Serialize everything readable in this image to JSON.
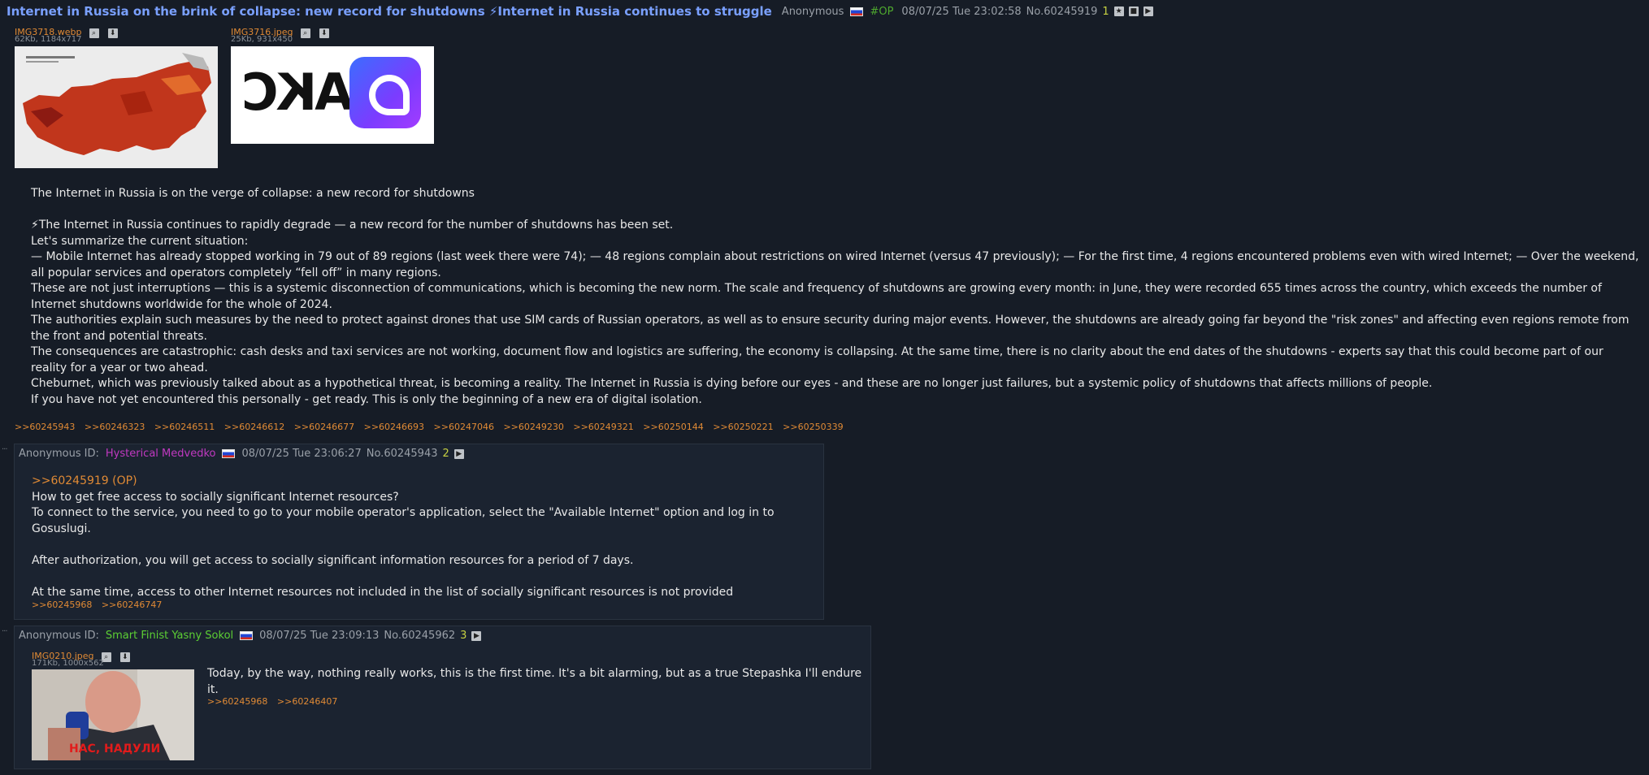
{
  "op": {
    "title": "Internet in Russia on the brink of collapse: new record for shutdowns ⚡Internet in Russia continues to struggle",
    "author": "Anonymous",
    "tag": "#OP",
    "datetime": "08/07/25 Tue 23:02:58",
    "number": "No.60245919",
    "reply_count": "1",
    "files": [
      {
        "name": "IMG3718.webp",
        "info": "62Kb, 1184x717"
      },
      {
        "name": "IMG3716.jpeg",
        "info": "25Kb, 931x450"
      }
    ],
    "maks_text": "МАКС",
    "body": [
      "The Internet in Russia is on the verge of collapse: a new record for shutdowns",
      "",
      "⚡The Internet in Russia continues to rapidly degrade — a new record for the number of shutdowns has been set.",
      "Let's summarize the current situation:",
      "— Mobile Internet has already stopped working in 79 out of 89 regions (last week there were 74); — 48 regions complain about restrictions on wired Internet (versus 47 previously); — For the first time, 4 regions encountered problems even with wired Internet; — Over the weekend, all popular services and operators completely “fell off” in many regions.",
      "These are not just interruptions — this is a systemic disconnection of communications, which is becoming the new norm. The scale and frequency of shutdowns are growing every month: in June, they were recorded 655 times across the country, which exceeds the number of Internet shutdowns worldwide for the whole of 2024.",
      "The authorities explain such measures by the need to protect against drones that use SIM cards of Russian operators, as well as to ensure security during major events. However, the shutdowns are already going far beyond the \"risk zones\" and affecting even regions remote from the front and potential threats.",
      "The consequences are catastrophic: cash desks and taxi services are not working, document flow and logistics are suffering, the economy is collapsing. At the same time, there is no clarity about the end dates of the shutdowns - experts say that this could become part of our reality for a year or two ahead.",
      "Cheburnet, which was previously talked about as a hypothetical threat, is becoming a reality. The Internet in Russia is dying before our eyes - and these are no longer just failures, but a systemic policy of shutdowns that affects millions of people.",
      "If you have not yet encountered this personally - get ready. This is only the beginning of a new era of digital isolation."
    ],
    "replies": [
      ">>60245943",
      ">>60246323",
      ">>60246511",
      ">>60246612",
      ">>60246677",
      ">>60246693",
      ">>60247046",
      ">>60249230",
      ">>60249321",
      ">>60250144",
      ">>60250221",
      ">>60250339"
    ]
  },
  "posts": [
    {
      "author": "Anonymous",
      "id_label": "ID:",
      "id_name": "Hysterical Medvedko",
      "datetime": "08/07/25 Tue 23:06:27",
      "number": "No.60245943",
      "reply_count": "2",
      "quote": ">>60245919 (OP)",
      "body": [
        "How to get free access to socially significant Internet resources?",
        "To connect to the service, you need to go to your mobile operator's application, select the \"Available Internet\" option and log in to Gosuslugi.",
        "",
        "After authorization, you will get access to socially significant information resources for a period of 7 days.",
        "",
        "At the same time, access to other Internet resources not included in the list of socially significant resources is not provided"
      ],
      "replies": [
        ">>60245968",
        ">>60246747"
      ]
    },
    {
      "author": "Anonymous",
      "id_label": "ID:",
      "id_name": "Smart Finist Yasny Sokol",
      "datetime": "08/07/25 Tue 23:09:13",
      "number": "No.60245962",
      "reply_count": "3",
      "file": {
        "name": "IMG0210.jpeg",
        "info": "171Kb, 1000x562"
      },
      "caption": "НАС, НАДУЛИ",
      "body": "Today, by the way, nothing really works, this is the first time. It's a bit alarming, but as a true Stepashka I'll endure it.",
      "replies": [
        ">>60245968",
        ">>60246407"
      ]
    }
  ]
}
